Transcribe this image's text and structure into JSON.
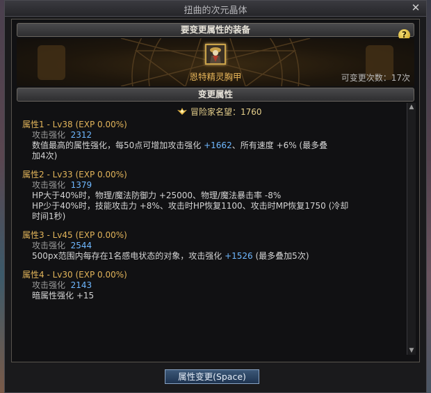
{
  "window": {
    "title": "扭曲的次元晶体",
    "close_glyph": "✕"
  },
  "equip_section": {
    "header": "要变更属性的装备",
    "help_glyph": "?",
    "item_name": "恩特精灵胸甲",
    "change_count": "可变更次数：17次"
  },
  "attr_section": {
    "header": "变更属性",
    "reputation": "冒险家名望：1760",
    "attributes": [
      {
        "title": "属性1 - Lv38 (EXP 0.00%)",
        "stat_label": "攻击强化",
        "stat_value": "2312",
        "desc_line1_a": "数值最高的属性强化，每50点可增加攻击强化",
        "desc_line1_num": "+1662",
        "desc_line1_b": "、所有速度 +6% (最多叠",
        "desc_line2": "加4次)"
      },
      {
        "title": "属性2 - Lv33 (EXP 0.00%)",
        "stat_label": "攻击强化",
        "stat_value": "1379",
        "desc_line1": "HP大于40%时，物理/魔法防御力 +25000、物理/魔法暴击率 -8%",
        "desc_line2": "HP少于40%时，技能攻击力 +8%、攻击时HP恢复1100、攻击时MP恢复1750 (冷却",
        "desc_line3": "时间1秒)"
      },
      {
        "title": "属性3 - Lv45 (EXP 0.00%)",
        "stat_label": "攻击强化",
        "stat_value": "2544",
        "desc_line1_a": "500px范围内每存在1名感电状态的对象，攻击强化",
        "desc_line1_num": "+1526",
        "desc_line1_b": " (最多叠加5次)"
      },
      {
        "title": "属性4 - Lv30 (EXP 0.00%)",
        "stat_label": "攻击强化",
        "stat_value": "2143",
        "desc_line1": "暗属性强化 +15"
      }
    ]
  },
  "scroll": {
    "up_glyph": "▲",
    "down_glyph": "▼"
  },
  "footer": {
    "change_button": "属性变更(Space)"
  },
  "colors": {
    "gold": "#e2b45a",
    "blue_value": "#6fb8ff",
    "button_blue": "#2b4566"
  },
  "icons": [
    "close-icon",
    "help-icon",
    "reputation-icon",
    "scroll-up-icon",
    "scroll-down-icon"
  ]
}
